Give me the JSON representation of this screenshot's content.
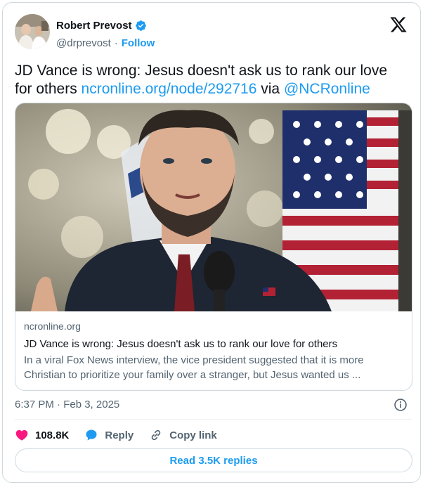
{
  "author": {
    "name": "Robert Prevost",
    "handle": "@drprevost",
    "separator": "·",
    "follow_label": "Follow",
    "verified": true
  },
  "tweet": {
    "text_before": "JD Vance is wrong: Jesus doesn't ask us to rank our love for others ",
    "link_text": "ncronline.org/node/292716",
    "via_text": " via ",
    "mention": "@NCRonline"
  },
  "link_card": {
    "domain": "ncronline.org",
    "title": "JD Vance is wrong: Jesus doesn't ask us to rank our love for others",
    "description": "In a viral Fox News interview, the vice president suggested that it is more Christian to prioritize your family over a stranger, but Jesus wanted us ..."
  },
  "meta": {
    "timestamp": "6:37 PM · Feb 3, 2025"
  },
  "actions": {
    "likes": "108.8K",
    "reply_label": "Reply",
    "copy_link_label": "Copy link",
    "read_replies_label": "Read 3.5K replies"
  },
  "colors": {
    "accent": "#1d9bf0",
    "like": "#f91880",
    "secondary_text": "#536471",
    "border": "#cfd9de"
  },
  "icons": [
    "verified-badge-icon",
    "x-logo-icon",
    "info-icon",
    "heart-icon",
    "reply-bubble-icon",
    "link-icon"
  ]
}
